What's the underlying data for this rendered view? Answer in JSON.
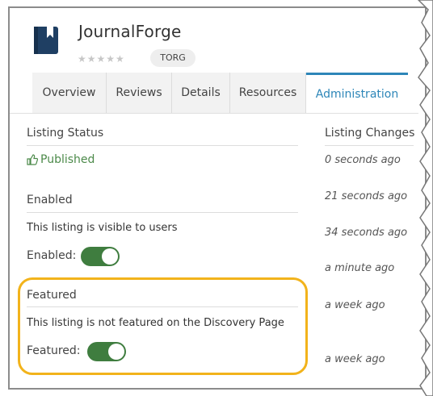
{
  "app": {
    "title": "JournalForge",
    "stars": "★★★★★",
    "tag": "TORG"
  },
  "tabs": [
    {
      "label": "Overview"
    },
    {
      "label": "Reviews"
    },
    {
      "label": "Details"
    },
    {
      "label": "Resources"
    },
    {
      "label": "Administration",
      "active": true
    }
  ],
  "listing_status": {
    "heading": "Listing Status",
    "status": "Published"
  },
  "enabled": {
    "heading": "Enabled",
    "description": "This listing is visible to users",
    "toggle_label": "Enabled:",
    "on": true
  },
  "featured": {
    "heading": "Featured",
    "description": "This listing is not featured on the Discovery Page",
    "toggle_label": "Featured:",
    "on": true
  },
  "listing_changes": {
    "heading": "Listing Changes",
    "items": [
      "0 seconds ago",
      "21 seconds ago",
      "34 seconds ago",
      "a minute ago",
      "a week ago",
      "a week ago"
    ]
  },
  "colors": {
    "accent": "#2d86b8",
    "toggle_on": "#3f7d3f",
    "published": "#4c8a4a",
    "highlight": "#f2b31b"
  }
}
